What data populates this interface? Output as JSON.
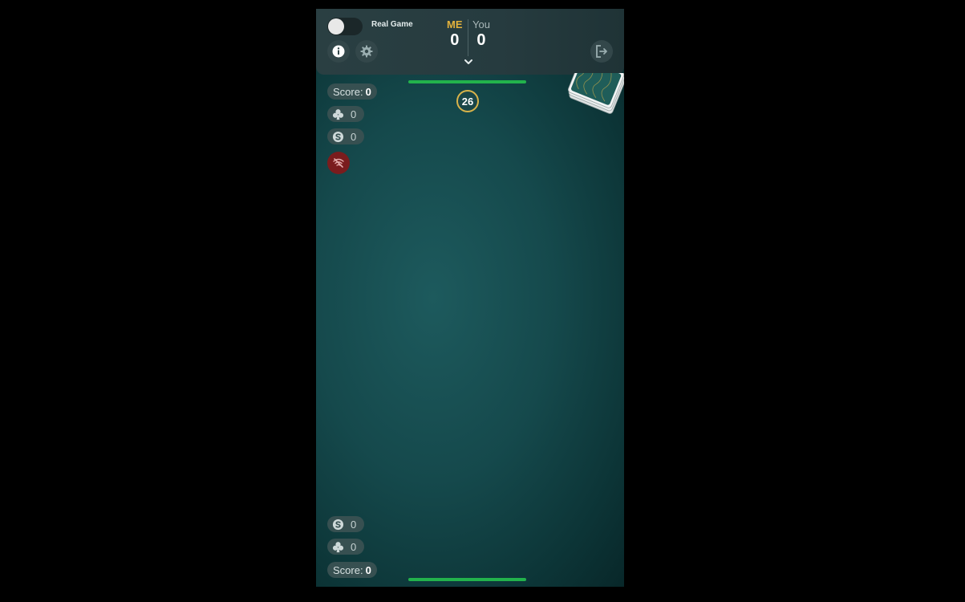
{
  "header": {
    "toggle_label": "Real Game",
    "toggle_on": false,
    "players": [
      {
        "name": "ME",
        "score": "0"
      },
      {
        "name": "You",
        "score": "0"
      }
    ]
  },
  "timer": {
    "value": "26"
  },
  "opponent": {
    "score_label": "Score:",
    "score_value": "0",
    "clubs_count": "0",
    "coins_count": "0"
  },
  "player": {
    "score_label": "Score:",
    "score_value": "0",
    "clubs_count": "0",
    "coins_count": "0"
  },
  "colors": {
    "accent": "#e3b23c",
    "progress": "#22b24c",
    "mute_button": "#7a1c1d",
    "felt": "#15494c"
  }
}
